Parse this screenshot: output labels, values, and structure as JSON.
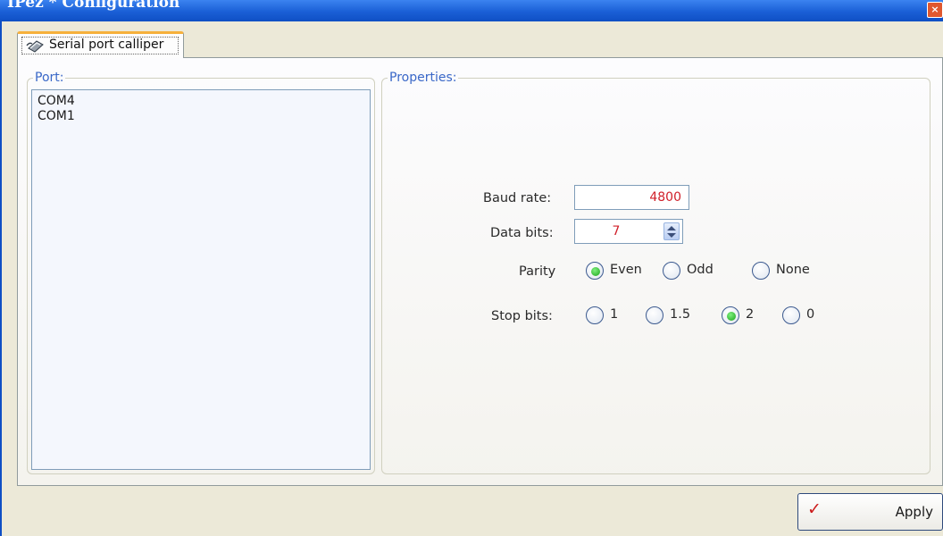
{
  "window": {
    "title": "IPez * Configuration",
    "close_glyph": "×"
  },
  "tab": {
    "label": "Serial port calliper",
    "icon": "serial-cable-icon"
  },
  "port_group": {
    "legend": "Port:",
    "items": [
      "COM4",
      "COM1"
    ]
  },
  "properties": {
    "legend": "Properties:",
    "baud_rate": {
      "label": "Baud rate:",
      "value": "4800"
    },
    "data_bits": {
      "label": "Data bits:",
      "value": "7"
    },
    "parity": {
      "label": "Parity",
      "options": [
        {
          "label": "Even",
          "selected": true
        },
        {
          "label": "Odd",
          "selected": false
        },
        {
          "label": "None",
          "selected": false
        }
      ]
    },
    "stop_bits": {
      "label": "Stop bits:",
      "options": [
        {
          "label": "1",
          "selected": false
        },
        {
          "label": "1.5",
          "selected": false
        },
        {
          "label": "2",
          "selected": true
        },
        {
          "label": "0",
          "selected": false
        }
      ]
    }
  },
  "apply_button": {
    "label": "Apply",
    "icon": "checkmark-icon"
  },
  "colors": {
    "value_text": "#d0202a",
    "legend_text": "#3a68c8",
    "title_bar": "#1a5fd6"
  }
}
